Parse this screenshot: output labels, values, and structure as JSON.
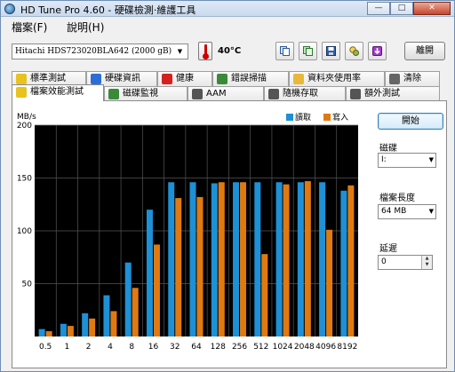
{
  "window": {
    "title": "HD Tune Pro 4.60 - 硬碟檢測‧維護工具"
  },
  "window_buttons": {
    "minimize": "—",
    "maximize": "□",
    "close": "✕"
  },
  "menu": {
    "items": [
      "檔案(F)",
      "說明(H)"
    ]
  },
  "toolbar": {
    "drive": "Hitachi HDS723020BLA642 (2000 gB)",
    "temperature": "40°C",
    "exit_label": "離開",
    "buttons": [
      "copy-text-icon",
      "copy-screenshot-icon",
      "save-icon",
      "options-icon",
      "download-icon"
    ]
  },
  "tabs_row1": [
    {
      "label": "標準測試",
      "icon": "benchmark-icon",
      "color": "#e8c21e"
    },
    {
      "label": "硬碟資訊",
      "icon": "info-icon",
      "color": "#2b6fd6"
    },
    {
      "label": "健康",
      "icon": "health-icon",
      "color": "#d62020"
    },
    {
      "label": "錯誤掃描",
      "icon": "magnifier-icon",
      "color": "#3a8a3a"
    },
    {
      "label": "資料夾使用率",
      "icon": "folder-icon",
      "color": "#e8b838"
    },
    {
      "label": "清除",
      "icon": "trash-icon",
      "color": "#666666"
    }
  ],
  "tabs_row2": [
    {
      "label": "檔案效能測試",
      "icon": "file-benchmark-icon",
      "color": "#e8c21e",
      "active": true
    },
    {
      "label": "磁碟監視",
      "icon": "monitor-icon",
      "color": "#3a8a3a"
    },
    {
      "label": "AAM",
      "icon": "speaker-icon",
      "color": "#555555"
    },
    {
      "label": "隨機存取",
      "icon": "random-access-icon",
      "color": "#555555"
    },
    {
      "label": "額外測試",
      "icon": "extra-tests-icon",
      "color": "#555555"
    }
  ],
  "side": {
    "start_label": "開始",
    "drive_label": "磁碟",
    "drive_value": "I:",
    "file_length_label": "檔案長度",
    "file_length_value": "64 MB",
    "delay_label": "延遲",
    "delay_value": "0"
  },
  "chart_data": {
    "type": "bar",
    "ylabel": "MB/s",
    "xlabel": "",
    "ylim": [
      0,
      200
    ],
    "yticks": [
      50,
      100,
      150,
      200
    ],
    "grid": true,
    "legend": "top-right",
    "categories": [
      "0.5",
      "1",
      "2",
      "4",
      "8",
      "16",
      "32",
      "64",
      "128",
      "256",
      "512",
      "1024",
      "2048",
      "4096",
      "8192"
    ],
    "series": [
      {
        "name": "讀取",
        "color": "#1e90d6",
        "values": [
          7,
          12,
          22,
          39,
          70,
          120,
          146,
          146,
          145,
          146,
          146,
          146,
          146,
          146,
          138
        ]
      },
      {
        "name": "寫入",
        "color": "#e07a10",
        "values": [
          5,
          10,
          17,
          24,
          46,
          87,
          131,
          132,
          146,
          146,
          78,
          144,
          147,
          101,
          143
        ]
      }
    ]
  }
}
